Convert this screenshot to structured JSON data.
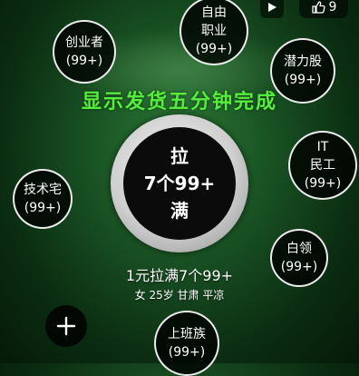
{
  "headline": "显示发货五分钟完成",
  "center": {
    "line1": "拉",
    "line2": "7个99+",
    "line3": "满"
  },
  "caption": {
    "title": "1元拉满7个99+",
    "subtitle": "女 25岁 甘肃 平凉"
  },
  "topbar": {
    "like_count": "9"
  },
  "tags": [
    {
      "line1": "创业者",
      "line2": "(99+)"
    },
    {
      "line1": "自由",
      "line2": "职业",
      "line3": "(99+)"
    },
    {
      "line1": "潜力股",
      "line2": "(99+)"
    },
    {
      "line1": "IT",
      "line2": "民工",
      "line3": "(99+)"
    },
    {
      "line1": "技术宅",
      "line2": "(99+)"
    },
    {
      "line1": "白领",
      "line2": "(99+)"
    },
    {
      "line1": "上班族",
      "line2": "(99+)"
    }
  ]
}
